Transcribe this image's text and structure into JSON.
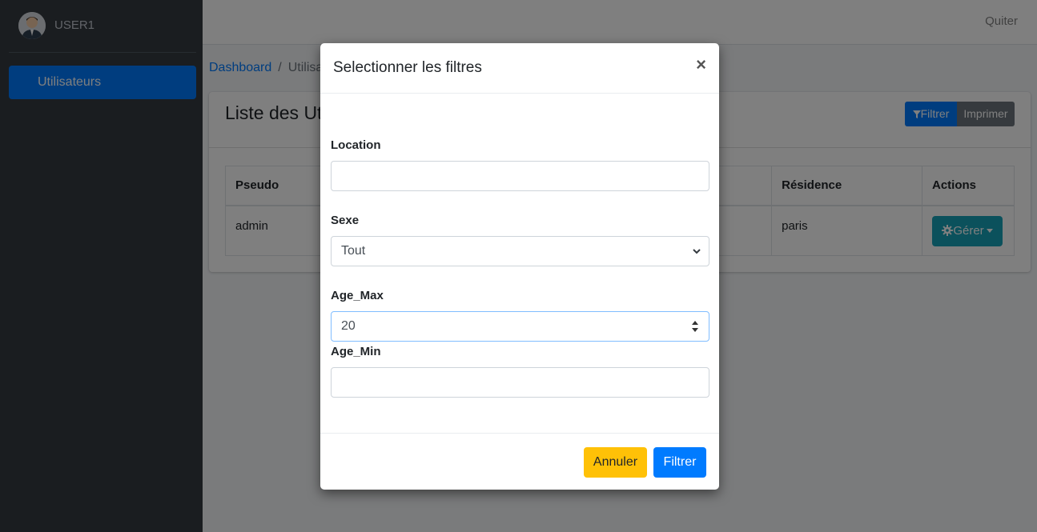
{
  "sidebar": {
    "user_name": "USER1",
    "items": [
      {
        "label": "Utilisateurs"
      }
    ]
  },
  "navbar": {
    "quit_label": "Quiter"
  },
  "breadcrumb": {
    "home": "Dashboard",
    "separator": "/",
    "current": "Utilisateurs"
  },
  "card": {
    "title": "Liste des Utilisateurs",
    "filter_label": "Filtrer",
    "print_label": "Imprimer",
    "table": {
      "headers": [
        "Pseudo",
        "Résidence",
        "Actions"
      ],
      "rows": [
        {
          "pseudo": "admin",
          "residence": "paris",
          "action_label": "Gérer"
        }
      ]
    }
  },
  "modal": {
    "title": "Selectionner les filtres",
    "close_symbol": "×",
    "location": {
      "label": "Location",
      "value": ""
    },
    "sexe": {
      "label": "Sexe",
      "selected": "Tout"
    },
    "age_max": {
      "label": "Age_Max",
      "value": "20"
    },
    "age_min": {
      "label": "Age_Min",
      "value": ""
    },
    "cancel_label": "Annuler",
    "apply_label": "Filtrer"
  },
  "colors": {
    "primary": "#007bff",
    "secondary": "#6c757d",
    "info": "#17a2b8",
    "warning": "#ffc107",
    "sidebar_bg": "#343a40"
  },
  "icons": {
    "filter": "filter-icon",
    "gear": "gear-icon",
    "avatar": "avatar-icon"
  }
}
